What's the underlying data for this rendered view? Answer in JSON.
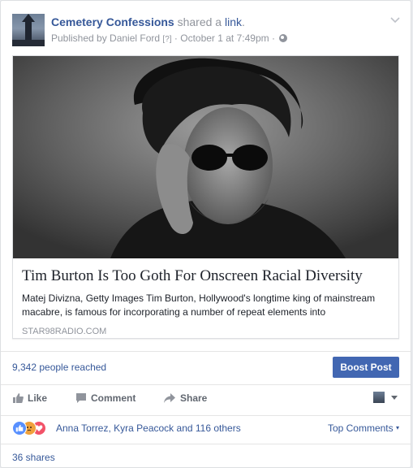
{
  "post": {
    "page_name": "Cemetery Confessions",
    "shared_text": "shared a",
    "shared_link": "link",
    "shared_period": ".",
    "published_by": "Published by Daniel Ford",
    "help_mark": "[?]",
    "separator": "·",
    "date": "October 1 at 7:49pm",
    "separator2": "·"
  },
  "link": {
    "title": "Tim Burton Is Too Goth For Onscreen Racial Diversity",
    "description": "Matej Divizna, Getty Images Tim Burton, Hollywood's longtime king of mainstream macabre, is famous for incorporating a number of repeat elements into",
    "domain": "STAR98RADIO.COM"
  },
  "insights": {
    "reach": "9,342 people reached",
    "boost_label": "Boost Post"
  },
  "actions": {
    "like": "Like",
    "comment": "Comment",
    "share": "Share"
  },
  "reactions": {
    "names": "Anna Torrez, Kyra Peacock and 116 others",
    "icons": [
      "like-icon",
      "angry-icon",
      "love-icon"
    ],
    "top_comments": "Top Comments"
  },
  "shares": {
    "count": "36 shares"
  },
  "colors": {
    "link_blue": "#365899",
    "boost_blue": "#4267b2",
    "meta_gray": "#90949c",
    "action_gray": "#616770"
  }
}
